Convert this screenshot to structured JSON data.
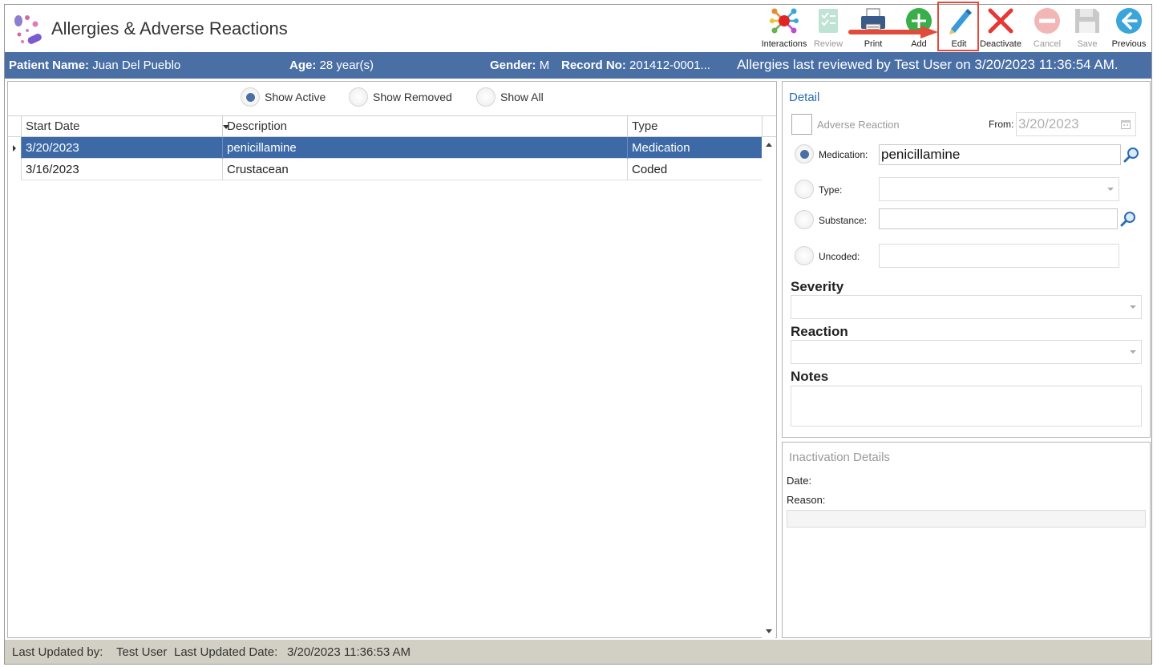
{
  "header": {
    "title": "Allergies & Adverse Reactions"
  },
  "toolbar": [
    {
      "label": "Interactions",
      "icon": "interactions-icon",
      "enabled": true
    },
    {
      "label": "Review",
      "icon": "review-icon",
      "enabled": false
    },
    {
      "label": "Print",
      "icon": "print-icon",
      "enabled": true
    },
    {
      "label": "Add",
      "icon": "add-icon",
      "enabled": true
    },
    {
      "label": "Edit",
      "icon": "edit-pencil-icon",
      "enabled": true
    },
    {
      "label": "Deactivate",
      "icon": "deactivate-x-icon",
      "enabled": true
    },
    {
      "label": "Cancel",
      "icon": "cancel-icon",
      "enabled": false
    },
    {
      "label": "Save",
      "icon": "save-icon",
      "enabled": false
    },
    {
      "label": "Previous",
      "icon": "previous-arrow-icon",
      "enabled": true
    }
  ],
  "patient": {
    "name_label": "Patient Name:",
    "name": "Juan Del Pueblo",
    "age_label": "Age:",
    "age": "28 year(s)",
    "gender_label": "Gender:",
    "gender": "M",
    "record_label": "Record No:",
    "record": "201412-0001...",
    "review_text": "Allergies last reviewed by Test User on 3/20/2023 11:36:54 AM."
  },
  "filters": {
    "show_active": "Show Active",
    "show_removed": "Show Removed",
    "show_all": "Show All",
    "selected": "Show Active"
  },
  "grid": {
    "columns": [
      "Start Date",
      "Description",
      "Type"
    ],
    "rows": [
      {
        "start_date": "3/20/2023",
        "description": "penicillamine",
        "type": "Medication",
        "selected": true
      },
      {
        "start_date": "3/16/2023",
        "description": "Crustacean",
        "type": "Coded",
        "selected": false
      }
    ]
  },
  "detail": {
    "title": "Detail",
    "adverse_reaction_label": "Adverse Reaction",
    "from_label": "From:",
    "from_value": "3/20/2023",
    "medication_label": "Medication:",
    "medication_value": "penicillamine",
    "type_label": "Type:",
    "type_value": "",
    "substance_label": "Substance:",
    "substance_value": "",
    "uncoded_label": "Uncoded:",
    "uncoded_value": "",
    "severity_label": "Severity",
    "reaction_label": "Reaction",
    "notes_label": "Notes"
  },
  "inactivation": {
    "title": "Inactivation Details",
    "date_label": "Date:",
    "reason_label": "Reason:"
  },
  "status": {
    "updated_by_label": "Last Updated by:",
    "updated_by": "Test User",
    "updated_date_label": "Last Updated Date:",
    "updated_date": "3/20/2023 11:36:53 AM"
  },
  "colors": {
    "patient_bar": "#4a6fa5",
    "selected_row": "#3d6aa6",
    "highlight": "#e14b3b",
    "status_bar": "#d2d0c4"
  }
}
